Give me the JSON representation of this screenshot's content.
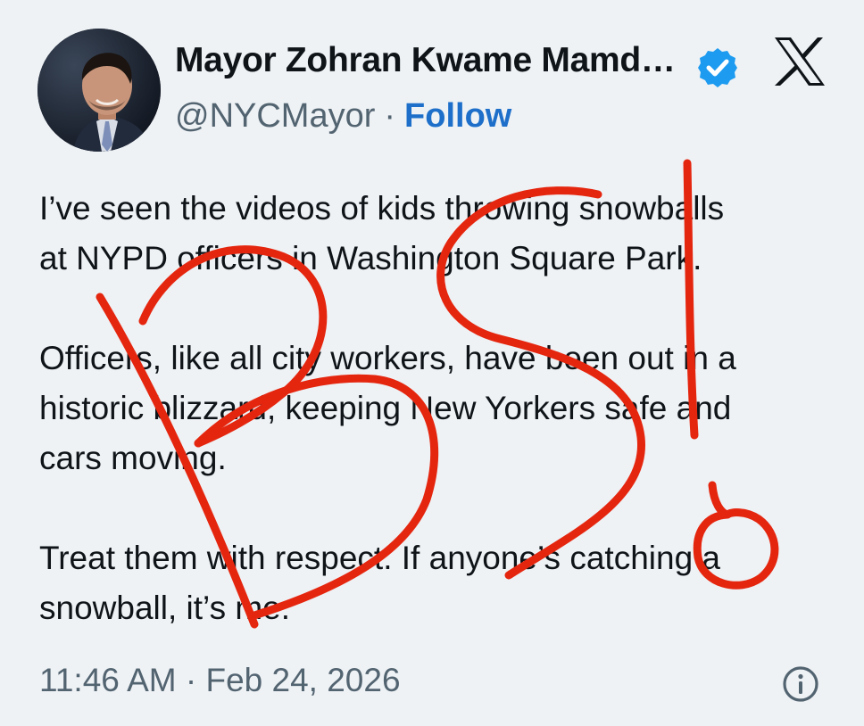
{
  "tweet": {
    "display_name": "Mayor Zohran Kwame Mamd…",
    "handle": "@NYCMayor",
    "separator": "·",
    "follow_label": "Follow",
    "verified_badge_icon": "verified-badge-icon",
    "platform_icon": "x-logo-icon",
    "paragraphs": [
      [
        "I’ve seen the videos of kids throwing snowballs",
        "at NYPD officers in Washington Square Park."
      ],
      [
        "Officers, like all city workers, have been out in a",
        "historic blizzard, keeping New Yorkers safe and",
        "cars moving."
      ],
      [
        "Treat them with respect. If anyone’s catching a",
        "snowball, it’s me."
      ]
    ],
    "timestamp": "11:46 AM · Feb 24, 2026",
    "info_icon": "info-icon"
  },
  "annotation": {
    "text": "BS!",
    "color": "#e5260f"
  },
  "colors": {
    "background": "#eef2f5",
    "text": "#0f1419",
    "muted": "#536471",
    "follow": "#1d6fc9",
    "verified": "#1d9bf0"
  }
}
